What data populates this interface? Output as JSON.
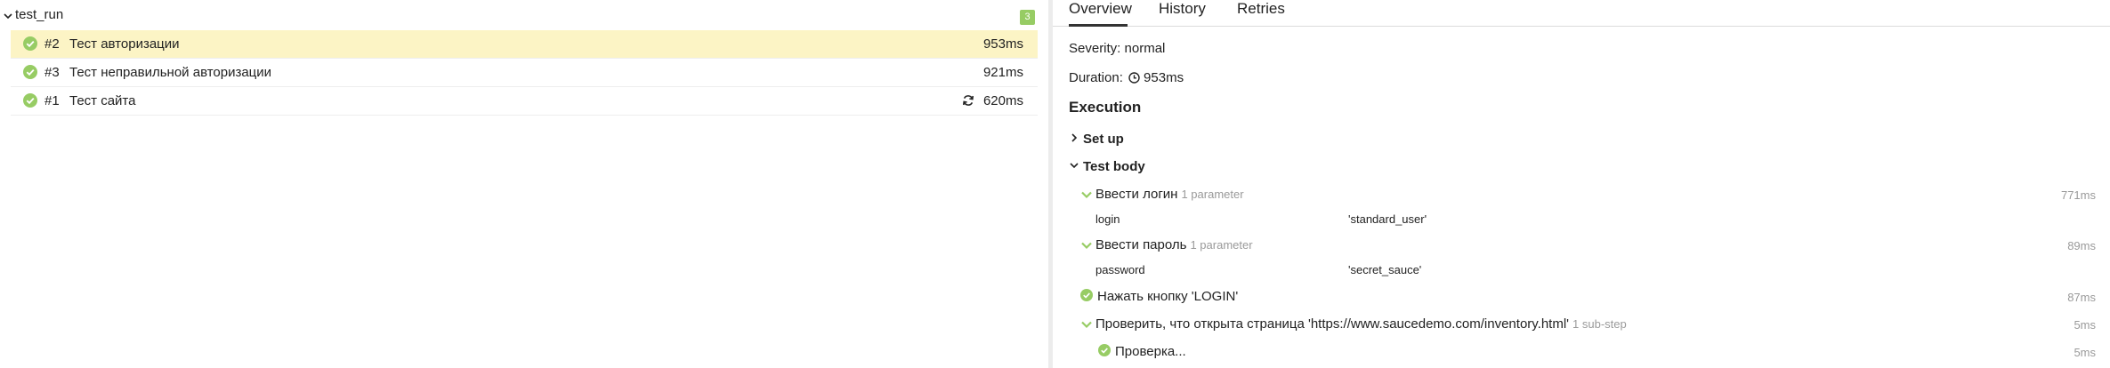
{
  "group": {
    "title": "test_run",
    "count": "3"
  },
  "tests": [
    {
      "num": "#2",
      "name": "Тест авторизации",
      "duration": "953ms",
      "selected": true,
      "retry": false
    },
    {
      "num": "#3",
      "name": "Тест неправильной авторизации",
      "duration": "921ms",
      "selected": false,
      "retry": false
    },
    {
      "num": "#1",
      "name": "Тест сайта",
      "duration": "620ms",
      "selected": false,
      "retry": true
    }
  ],
  "tabs": {
    "overview": "Overview",
    "history": "History",
    "retries": "Retries"
  },
  "details": {
    "severity": "Severity: normal",
    "duration_label": "Duration:",
    "duration_value": "953ms",
    "execution_title": "Execution",
    "setup_label": "Set up",
    "body_label": "Test body"
  },
  "steps": [
    {
      "name": "Ввести логин",
      "meta": "1 parameter",
      "duration": "771ms",
      "param_name": "login",
      "param_value": "'standard_user'"
    },
    {
      "name": "Ввести пароль",
      "meta": "1 parameter",
      "duration": "89ms",
      "param_name": "password",
      "param_value": "'secret_sauce'"
    },
    {
      "name": "Нажать кнопку 'LOGIN'",
      "duration": "87ms"
    },
    {
      "name": "Проверить, что открыта страница 'https://www.saucedemo.com/inventory.html'",
      "meta": "1 sub-step",
      "duration": "5ms"
    },
    {
      "name": "Проверка...",
      "duration": "5ms"
    }
  ],
  "colors": {
    "passed": "#97cc64",
    "selected_row": "#fcf4c5",
    "muted": "#9a9a9a"
  }
}
